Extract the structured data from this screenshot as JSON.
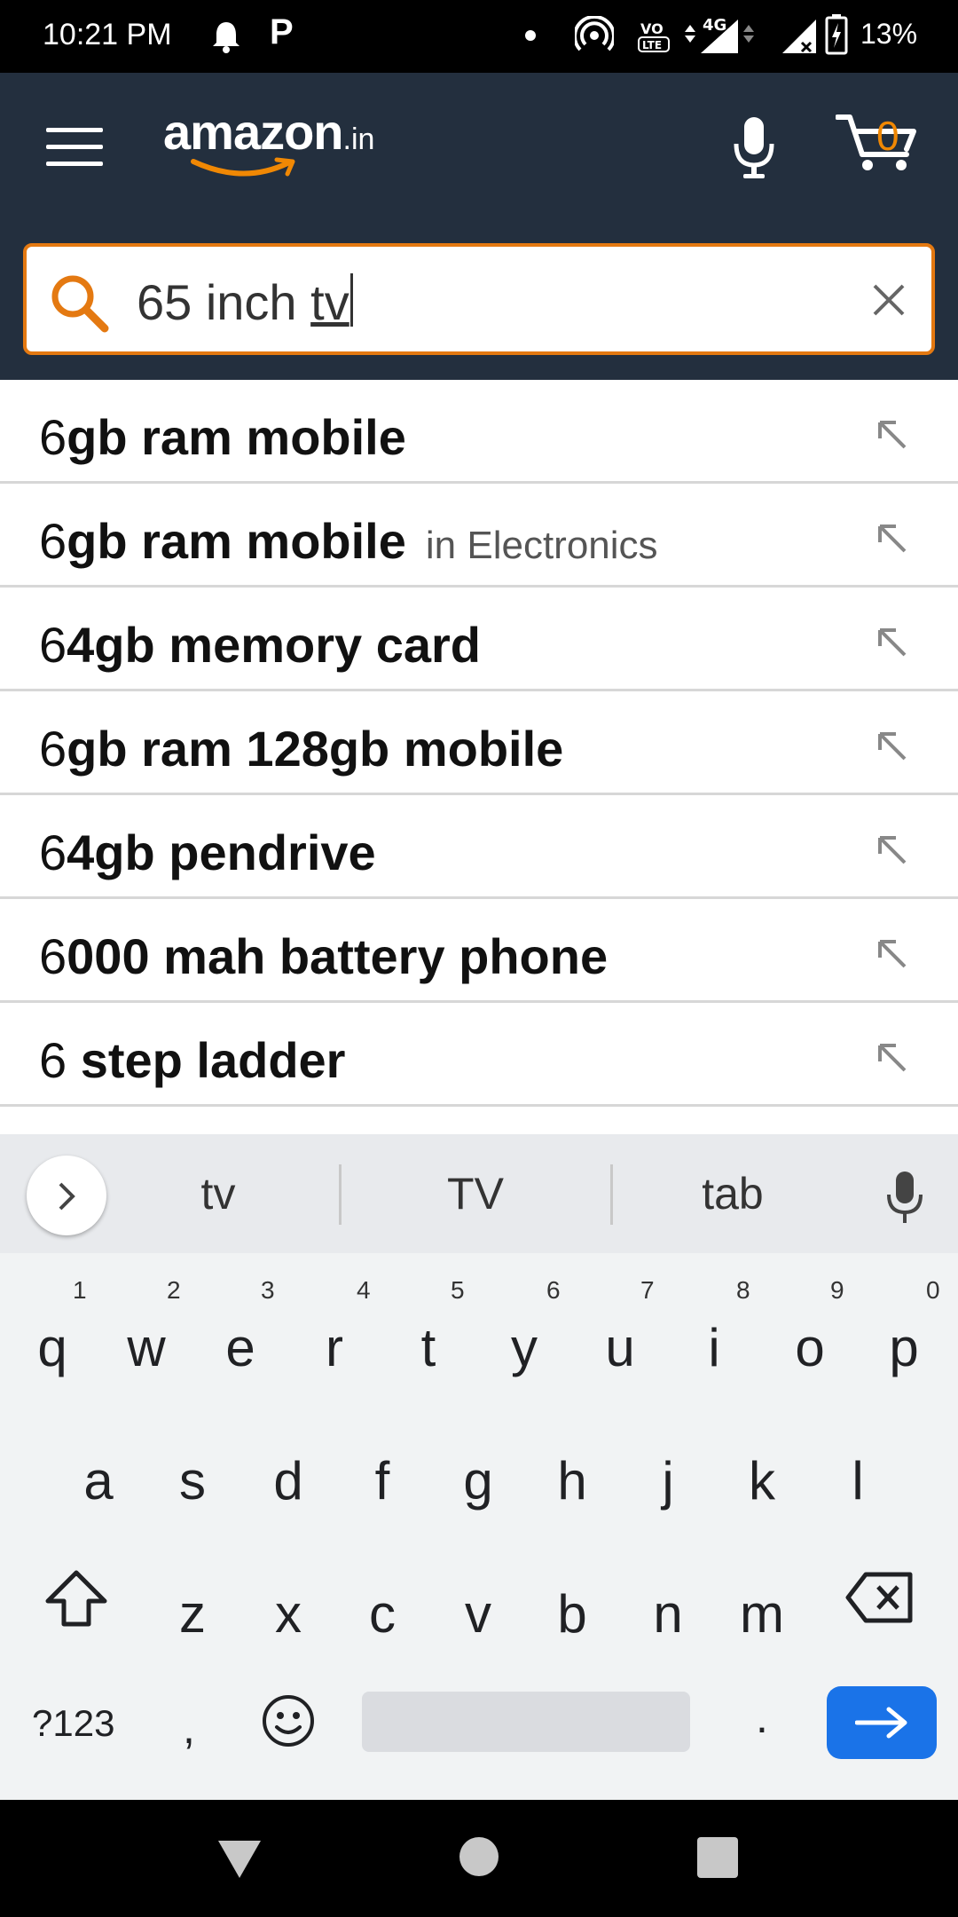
{
  "status_bar": {
    "time": "10:21 PM",
    "network": "4G",
    "battery": "13%"
  },
  "header": {
    "logo": "amazon",
    "logo_tld": ".in",
    "cart_count": "0"
  },
  "search": {
    "value_prefix": "65 inch ",
    "value_typed": "tv"
  },
  "suggestions": [
    {
      "prefix": "6",
      "rest": "gb ram mobile",
      "category": ""
    },
    {
      "prefix": "6",
      "rest": "gb ram mobile",
      "category": "in Electronics"
    },
    {
      "prefix": "6",
      "rest": "4gb memory card",
      "category": ""
    },
    {
      "prefix": "6",
      "rest": "gb ram 128gb mobile",
      "category": ""
    },
    {
      "prefix": "6",
      "rest": "4gb pendrive",
      "category": ""
    },
    {
      "prefix": "6",
      "rest": "000 mah battery phone",
      "category": ""
    },
    {
      "prefix": "6 ",
      "rest": "step ladder",
      "category": ""
    }
  ],
  "keyboard": {
    "suggestions": [
      "tv",
      "TV",
      "tab"
    ],
    "row1": [
      "q",
      "w",
      "e",
      "r",
      "t",
      "y",
      "u",
      "i",
      "o",
      "p"
    ],
    "row1_hints": [
      "1",
      "2",
      "3",
      "4",
      "5",
      "6",
      "7",
      "8",
      "9",
      "0"
    ],
    "row2": [
      "a",
      "s",
      "d",
      "f",
      "g",
      "h",
      "j",
      "k",
      "l"
    ],
    "row3": [
      "z",
      "x",
      "c",
      "v",
      "b",
      "n",
      "m"
    ],
    "symbols": "?123",
    "comma": ",",
    "period": "."
  },
  "colors": {
    "header_bg": "#232f3e",
    "accent_orange": "#e47911",
    "enter_blue": "#1a73e8"
  }
}
